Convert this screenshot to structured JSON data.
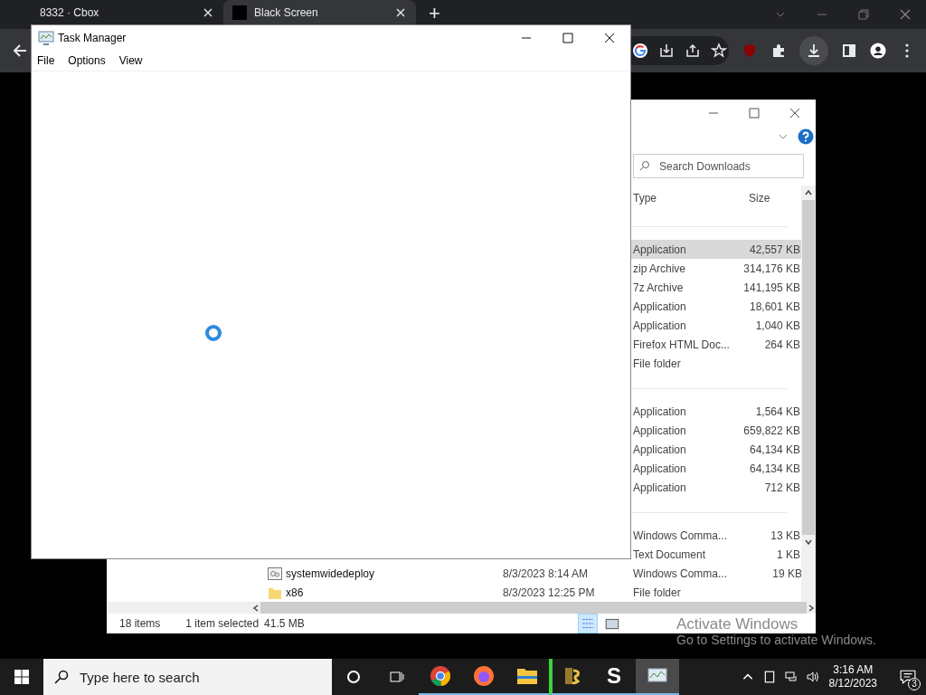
{
  "browser": {
    "tabs": [
      {
        "title": "8332 · Cbox",
        "selected": false
      },
      {
        "title": "Black Screen",
        "selected": true
      }
    ],
    "new_tab": "+"
  },
  "explorer": {
    "search": {
      "placeholder": "Search Downloads"
    },
    "columns": [
      "Type",
      "Size"
    ],
    "groups": [
      {
        "rows": [
          {
            "type": "Application",
            "size": "42,557 KB",
            "selected": true
          },
          {
            "type": "zip Archive",
            "size": "314,176 KB",
            "selected": false
          },
          {
            "type": "7z Archive",
            "size": "141,195 KB",
            "selected": false
          },
          {
            "type": "Application",
            "size": "18,601 KB",
            "selected": false
          },
          {
            "type": "Application",
            "size": "1,040 KB",
            "selected": false
          },
          {
            "type": "Firefox HTML Doc...",
            "size": "264 KB",
            "selected": false
          },
          {
            "type": "File folder",
            "selected": false
          }
        ]
      },
      {
        "rows": [
          {
            "type": "Application",
            "size": "1,564 KB",
            "selected": false
          },
          {
            "type": "Application",
            "size": "659,822 KB",
            "selected": false
          },
          {
            "type": "Application",
            "size": "64,134 KB",
            "selected": false
          },
          {
            "type": "Application",
            "size": "64,134 KB",
            "selected": false
          },
          {
            "type": "Application",
            "size": "712 KB",
            "selected": false
          }
        ]
      },
      {
        "rows": [
          {
            "type": "Windows Comma...",
            "size": "13 KB",
            "selected": false
          },
          {
            "type": "Text Document",
            "size": "1 KB",
            "selected": false
          },
          {
            "kind": "script",
            "name": "systemwidedeploy",
            "date": "8/3/2023 8:14 AM",
            "type": "Windows Comma...",
            "size": "19 KB",
            "selected": false
          },
          {
            "kind": "folder",
            "name": "x86",
            "date": "8/3/2023 12:25 PM",
            "type": "File folder",
            "selected": false
          }
        ]
      }
    ],
    "status": {
      "count": "18 items",
      "selection": "1 item selected",
      "size": "41.5 MB"
    }
  },
  "task_manager": {
    "title": "Task Manager",
    "menu": [
      "File",
      "Options",
      "View"
    ]
  },
  "activation_notice": {
    "title": "Activate Windows",
    "text": "Go to Settings to activate Windows."
  },
  "taskbar": {
    "search": {
      "placeholder": "Type here to search"
    },
    "apps": [
      {
        "kind": "chrome",
        "selected": false
      },
      {
        "kind": "firefox",
        "selected": false
      },
      {
        "kind": "files",
        "selected": false
      },
      {
        "kind": "bs",
        "selected": false
      },
      {
        "kind": "s",
        "label": "S",
        "selected": false
      },
      {
        "kind": "monitor",
        "selected": true
      }
    ],
    "time": "3:16 AM",
    "date": "8/12/2023",
    "notifications": "3"
  }
}
